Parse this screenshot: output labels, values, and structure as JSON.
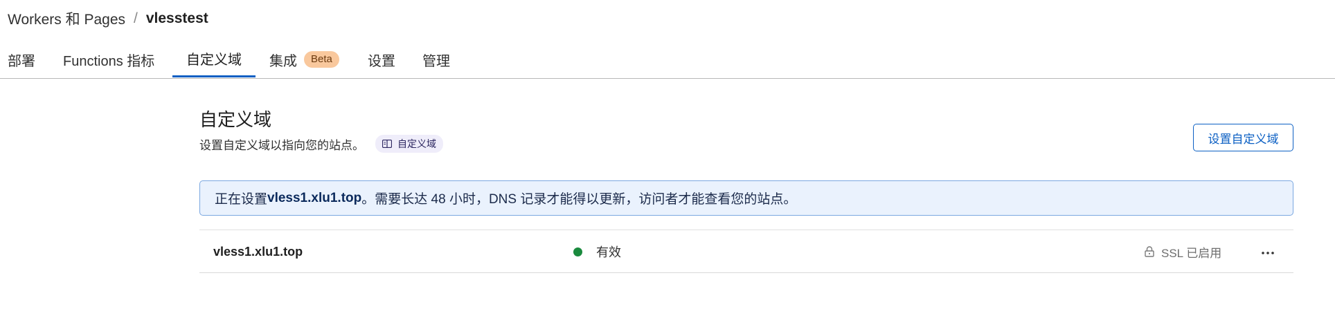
{
  "breadcrumb": {
    "parent": "Workers 和 Pages",
    "separator": "/",
    "current": "vlesstest"
  },
  "tabs": [
    {
      "label": "部署",
      "active": false
    },
    {
      "label": "Functions 指标",
      "active": false
    },
    {
      "label": "自定义域",
      "active": true
    },
    {
      "label": "集成",
      "badge": "Beta",
      "active": false
    },
    {
      "label": "设置",
      "active": false
    },
    {
      "label": "管理",
      "active": false
    }
  ],
  "main": {
    "title": "自定义域",
    "subtitle": "设置自定义域以指向您的站点。",
    "docs_link": {
      "label": "自定义域",
      "icon": "book-icon"
    },
    "setup_button": "设置自定义域"
  },
  "banner": {
    "prefix": "正在设置 ",
    "domain": "vless1.xlu1.top",
    "suffix": "。需要长达 48 小时，DNS 记录才能得以更新，访问者才能查看您的站点。"
  },
  "domains": [
    {
      "name": "vless1.xlu1.top",
      "status": "有效",
      "status_color": "#1a8a3e",
      "ssl": "SSL 已启用",
      "ssl_icon": "lock-icon",
      "menu_icon": "more-icon"
    }
  ],
  "colors": {
    "accent": "#0b5fc3",
    "beta_badge_bg": "#f9c89d",
    "banner_bg": "#eaf2fd",
    "banner_border": "#7aa7e0",
    "doc_pill_bg": "#efedfa"
  }
}
